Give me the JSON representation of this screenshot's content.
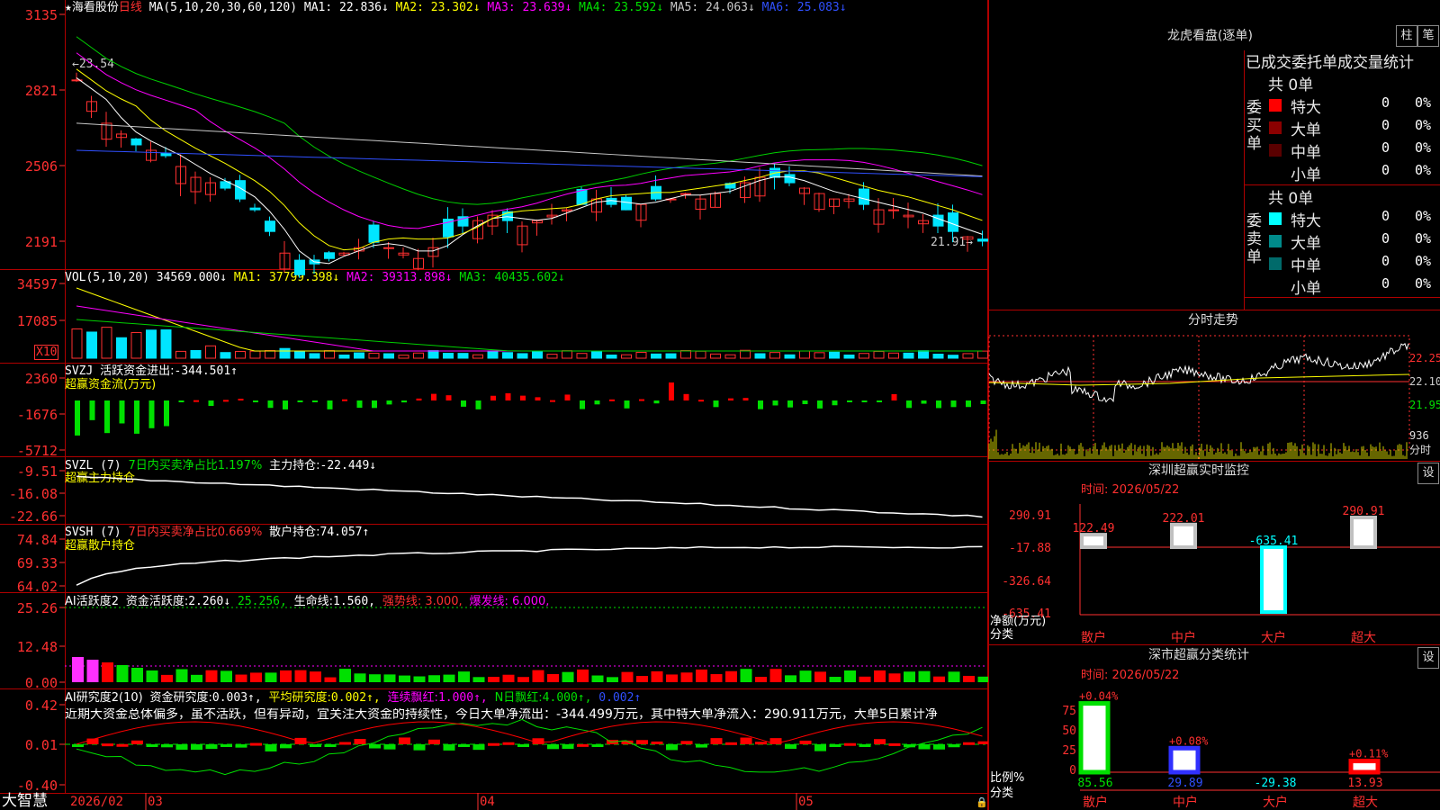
{
  "header": {
    "star": "★",
    "stock_name": "海看股份",
    "period": "日线",
    "ma_params": "MA(5,10,20,30,60,120)",
    "mas": [
      {
        "label": "MA1:",
        "value": "22.836↓",
        "color": "#ffffff"
      },
      {
        "label": "MA2:",
        "value": "23.302↓",
        "color": "#ffff00"
      },
      {
        "label": "MA3:",
        "value": "23.639↓",
        "color": "#ff00ff"
      },
      {
        "label": "MA4:",
        "value": "23.592↓",
        "color": "#00e000"
      },
      {
        "label": "MA5:",
        "value": "24.063↓",
        "color": "#c8c8c8"
      },
      {
        "label": "MA6:",
        "value": "25.083↓",
        "color": "#3050ff"
      }
    ]
  },
  "price_panel": {
    "y_ticks": [
      "3135",
      "2821",
      "2506",
      "2191"
    ],
    "high_mark": "23.54",
    "low_mark": "21.91"
  },
  "vol_panel": {
    "title": "VOL(5,10,20)",
    "value": "34569.000↓",
    "mas": [
      {
        "label": "MA1:",
        "value": "37799.398↓",
        "color": "#ffff00"
      },
      {
        "label": "MA2:",
        "value": "39313.898↓",
        "color": "#ff00ff"
      },
      {
        "label": "MA3:",
        "value": "40435.602↓",
        "color": "#00e000"
      }
    ],
    "y_ticks": [
      "34597",
      "17085"
    ],
    "unit": "X10"
  },
  "svzj_panel": {
    "title": "SVZJ",
    "label": "活跃资金进出:",
    "value": "-344.501↑",
    "sub": "超赢资金流(万元)",
    "y_ticks": [
      "2360",
      "-1676",
      "-5712"
    ]
  },
  "svzl_panel": {
    "title": "SVZL (7)",
    "ratio": "7日内买卖净占比1.197%",
    "label": "主力持仓:",
    "value": "-22.449↓",
    "sub": "超赢主力持仓",
    "y_ticks": [
      "-9.51",
      "-16.08",
      "-22.66"
    ]
  },
  "svsh_panel": {
    "title": "SVSH (7)",
    "ratio": "7日内买卖净占比0.669%",
    "label": "散户持仓:",
    "value": "74.057↑",
    "sub": "超赢散户持仓",
    "y_ticks": [
      "74.84",
      "69.33",
      "64.02"
    ]
  },
  "ai_active_panel": {
    "title": "AI活跃度2",
    "label": "资金活跃度:",
    "value": "2.260↓",
    "value2": "25.256,",
    "life_label": "生命线:",
    "life_value": "1.560,",
    "strong": "强势线: 3.000,",
    "burst": "爆发线: 6.000,",
    "y_ticks": [
      "25.26",
      "12.48",
      "0.00"
    ]
  },
  "ai_research_panel": {
    "title": "AI研究度2(10)",
    "label": "资金研究度:",
    "value": "0.003↑,",
    "avg_label": "平均研究度:",
    "avg_value": "0.002↑,",
    "streak_label": "连续飘红:",
    "streak_value": "1.000↑,",
    "nday_label": "N日飘红:",
    "nday_value": "4.000↑,",
    "last": "0.002↑",
    "comment": "近期大资金总体偏多，虽不活跃，但有异动，宜关注大资金的持续性，今日大单净流出：-344.499万元，其中特大单净流入：290.911万元，大单5日累计净",
    "y_ticks": [
      "0.42",
      "0.01",
      "-0.40"
    ]
  },
  "x_axis": {
    "brand": "大智慧",
    "labels": [
      "2026/02",
      "03",
      "04",
      "05"
    ]
  },
  "dragon": {
    "title": "龙虎看盘(逐单)",
    "btn1": "柱",
    "btn2": "笔",
    "stat_title": "已成交委托单成交量统计",
    "buy_head": "共 0单",
    "buy_side": "委买单",
    "buy_rows": [
      {
        "name": "特大",
        "count": "0",
        "pct": "0%",
        "color": "#ff0000"
      },
      {
        "name": "大单",
        "count": "0",
        "pct": "0%",
        "color": "#8b0000"
      },
      {
        "name": "中单",
        "count": "0",
        "pct": "0%",
        "color": "#5a0000"
      },
      {
        "name": "小单",
        "count": "0",
        "pct": "0%",
        "color": "#000000"
      }
    ],
    "sell_head": "共 0单",
    "sell_side": "委卖单",
    "sell_rows": [
      {
        "name": "特大",
        "count": "0",
        "pct": "0%",
        "color": "#00ffff"
      },
      {
        "name": "大单",
        "count": "0",
        "pct": "0%",
        "color": "#008b8b"
      },
      {
        "name": "中单",
        "count": "0",
        "pct": "0%",
        "color": "#006a6a"
      },
      {
        "name": "小单",
        "count": "0",
        "pct": "0%",
        "color": "#000000"
      }
    ]
  },
  "intraday": {
    "title": "分时走势",
    "right_ticks": [
      "22.25",
      "22.10",
      "21.95"
    ],
    "vol_ticks": [
      "936",
      "分时"
    ]
  },
  "monitor": {
    "title": "深圳超赢实时监控",
    "set": "设",
    "time": "时间: 2026/05/22",
    "y_ticks": [
      "290.91",
      "-17.88",
      "-326.64",
      "-635.41"
    ],
    "unit1": "净额(万元)",
    "unit2": "分类",
    "bars": [
      {
        "cat": "散户",
        "value": 122.49,
        "label": "122.49"
      },
      {
        "cat": "中户",
        "value": 222.01,
        "label": "222.01"
      },
      {
        "cat": "大户",
        "value": -635.41,
        "label": "-635.41"
      },
      {
        "cat": "超大",
        "value": 290.91,
        "label": "290.91"
      }
    ]
  },
  "classify": {
    "title": "深市超赢分类统计",
    "set": "设",
    "time": "时间: 2026/05/22",
    "y_ticks": [
      "75",
      "50",
      "25",
      "0"
    ],
    "unit1": "比例%",
    "unit2": "分类",
    "bars": [
      {
        "cat": "散户",
        "pct": 85.56,
        "label": "85.56",
        "top": "+0.04%"
      },
      {
        "cat": "中户",
        "pct": 29.89,
        "label": "29.89",
        "top": "+0.08%"
      },
      {
        "cat": "大户",
        "pct": -29.38,
        "label": "-29.38",
        "top": ""
      },
      {
        "cat": "超大",
        "pct": 13.93,
        "label": "13.93",
        "top": "+0.11%"
      }
    ]
  }
}
